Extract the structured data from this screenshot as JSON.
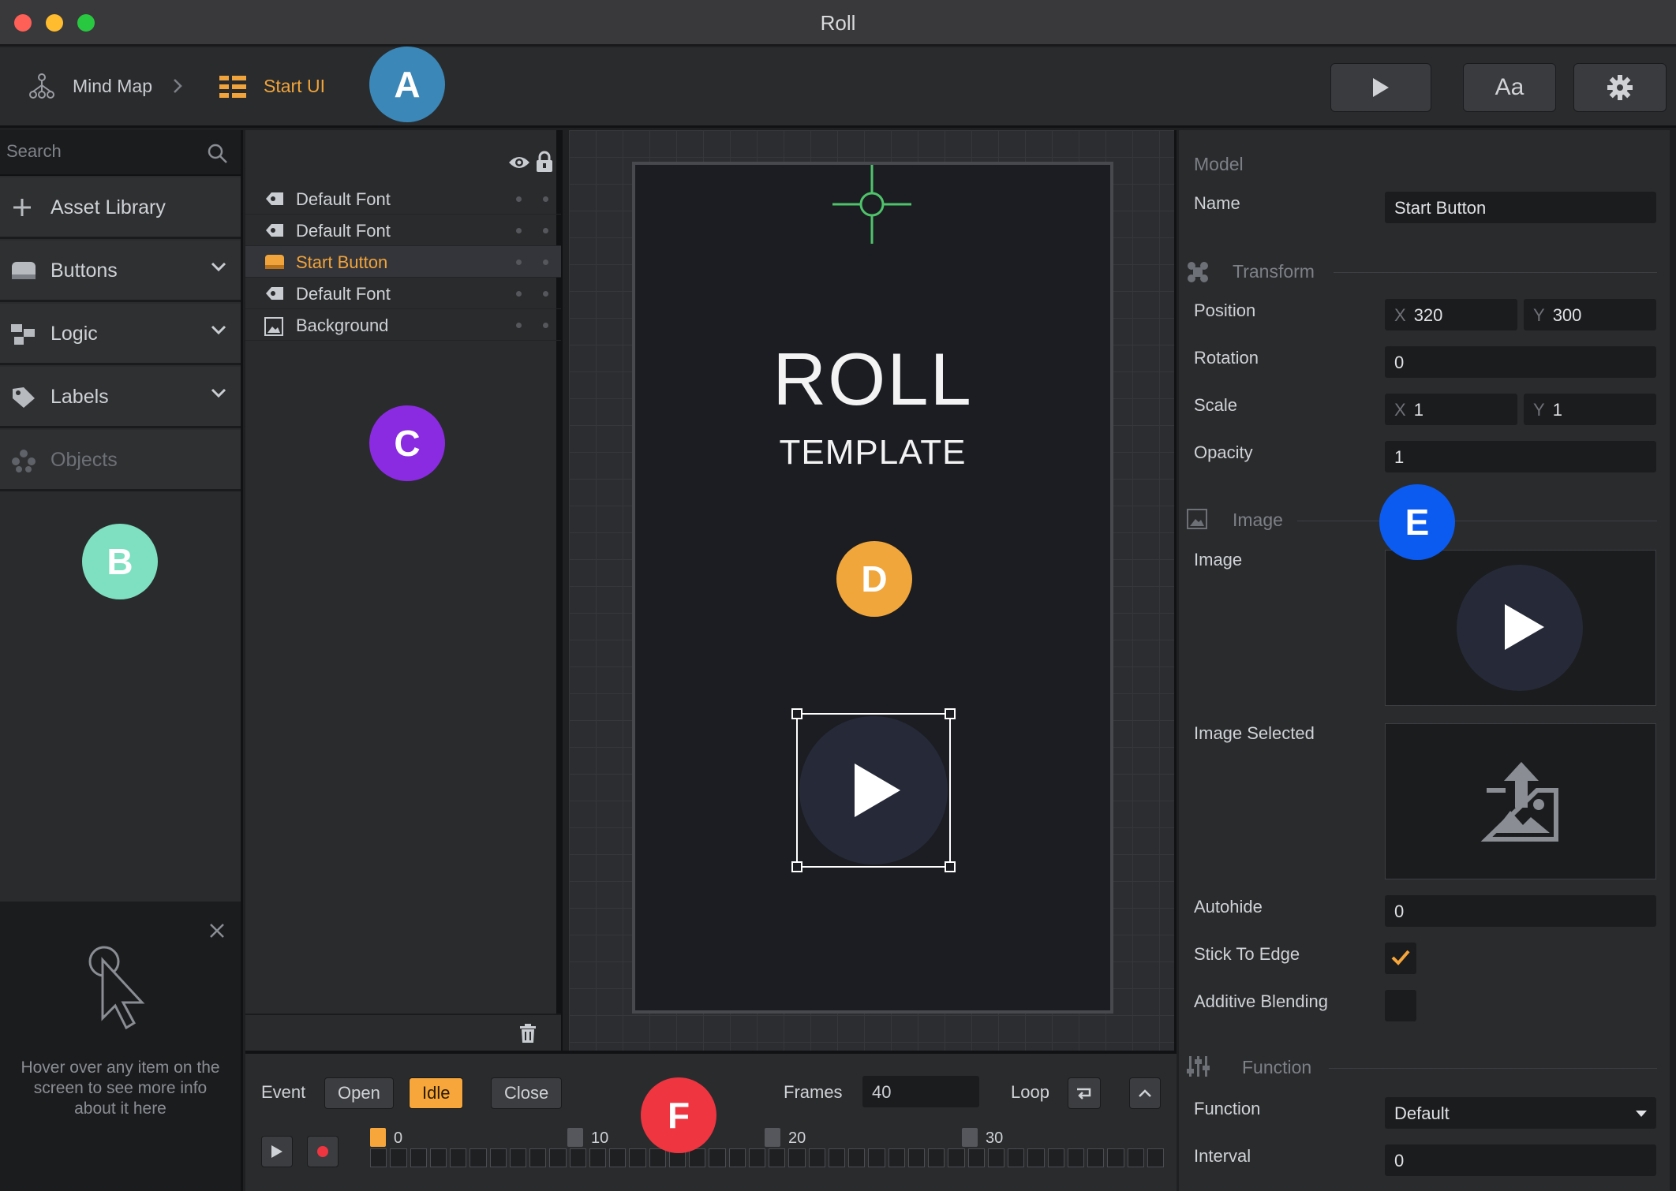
{
  "window": {
    "title": "Roll"
  },
  "toolbar": {
    "breadcrumb": [
      "Mind Map",
      "Start UI"
    ],
    "font_button": "Aa"
  },
  "badges": {
    "a": "A",
    "b": "B",
    "c": "C",
    "d": "D",
    "e": "E",
    "f": "F"
  },
  "sidebar": {
    "search_placeholder": "Search",
    "sections": [
      {
        "label": "Asset Library",
        "icon": "plus-icon"
      },
      {
        "label": "Buttons",
        "icon": "button-icon"
      },
      {
        "label": "Logic",
        "icon": "logic-icon"
      },
      {
        "label": "Labels",
        "icon": "tag-icon"
      },
      {
        "label": "Objects",
        "icon": "objects-icon"
      }
    ],
    "help_text": "Hover over any item on the screen to see more info about it here"
  },
  "layers": {
    "items": [
      {
        "label": "Default Font",
        "icon": "label-icon"
      },
      {
        "label": "Default Font",
        "icon": "label-icon"
      },
      {
        "label": "Start Button",
        "icon": "button-icon",
        "selected": true
      },
      {
        "label": "Default Font",
        "icon": "label-icon"
      },
      {
        "label": "Background",
        "icon": "image-icon"
      }
    ]
  },
  "canvas": {
    "title": "ROLL",
    "subtitle": "TEMPLATE"
  },
  "timeline": {
    "event_label": "Event",
    "events": [
      "Open",
      "Idle",
      "Close"
    ],
    "active_event": "Idle",
    "frames_label": "Frames",
    "frames_value": "40",
    "loop_label": "Loop",
    "frame_markers": [
      "0",
      "10",
      "20",
      "30"
    ]
  },
  "properties": {
    "model_header": "Model",
    "name_label": "Name",
    "name_value": "Start Button",
    "transform_header": "Transform",
    "position_label": "Position",
    "position_x": "320",
    "position_y": "300",
    "rotation_label": "Rotation",
    "rotation_value": "0",
    "scale_label": "Scale",
    "scale_x": "1",
    "scale_y": "1",
    "opacity_label": "Opacity",
    "opacity_value": "1",
    "image_header": "Image",
    "image_label": "Image",
    "image_selected_label": "Image Selected",
    "autohide_label": "Autohide",
    "autohide_value": "0",
    "stick_label": "Stick To Edge",
    "stick_checked": true,
    "additive_label": "Additive Blending",
    "additive_checked": false,
    "function_header": "Function",
    "function_label": "Function",
    "function_value": "Default",
    "interval_label": "Interval",
    "interval_value": "0",
    "axis_x": "X",
    "axis_y": "Y"
  },
  "colors": {
    "accent": "#f6a63b",
    "badge_a": "#3a87b8",
    "badge_b": "#7ee0c0",
    "badge_c": "#8a2be2",
    "badge_d": "#f0a63a",
    "badge_e": "#0b5bf0",
    "badge_f": "#ee3540"
  }
}
